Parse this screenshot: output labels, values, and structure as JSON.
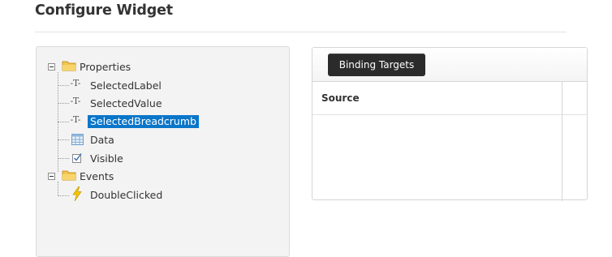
{
  "page": {
    "title": "Configure Widget"
  },
  "tree": {
    "properties": {
      "label": "Properties",
      "children": [
        {
          "label": "SelectedLabel",
          "icon": "text-property-icon"
        },
        {
          "label": "SelectedValue",
          "icon": "text-property-icon"
        },
        {
          "label": "SelectedBreadcrumb",
          "icon": "text-property-icon",
          "selected": true
        },
        {
          "label": "Data",
          "icon": "data-table-icon"
        },
        {
          "label": "Visible",
          "icon": "checkbox-property-icon"
        }
      ]
    },
    "events": {
      "label": "Events",
      "children": [
        {
          "label": "DoubleClicked",
          "icon": "lightning-icon"
        }
      ]
    }
  },
  "binding": {
    "button_label": "Binding Targets",
    "columns": [
      "Source"
    ]
  },
  "colors": {
    "selection": "#0a76c9",
    "button_bg": "#2b2b2b",
    "folder": "#f2c44e",
    "lightning": "#f5c400"
  }
}
